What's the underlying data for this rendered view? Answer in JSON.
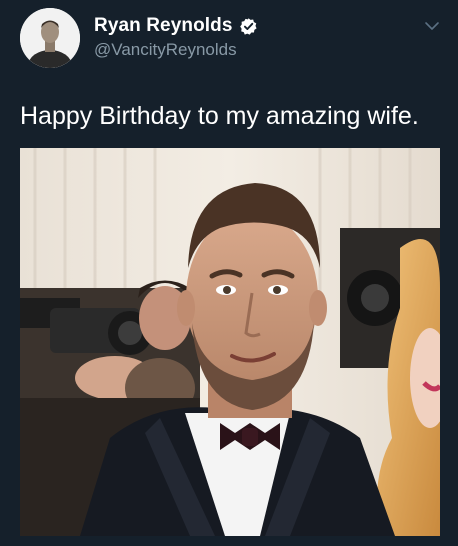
{
  "tweet": {
    "author": {
      "display_name": "Ryan Reynolds",
      "handle": "@VancityReynolds",
      "verified": true,
      "avatar_icon": "profile-photo"
    },
    "text": "Happy Birthday to my amazing wife.",
    "media": {
      "type": "photo"
    },
    "menu_icon": "chevron-down-icon"
  },
  "colors": {
    "background": "#15202b",
    "name": "#ffffff",
    "handle": "#8899a6",
    "verified_badge": "#ffffff"
  }
}
